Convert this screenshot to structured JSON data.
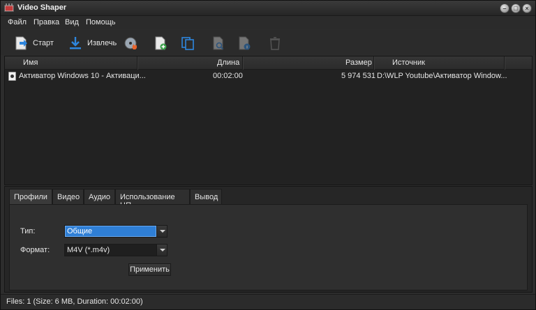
{
  "window": {
    "title": "Video Shaper"
  },
  "menu": [
    "Файл",
    "Правка",
    "Вид",
    "Помощь"
  ],
  "toolbar": {
    "start_label": "Старт",
    "extract_label": "Извлечь"
  },
  "list": {
    "columns": [
      "Имя",
      "Длина",
      "Размер",
      "Источник"
    ],
    "rows": [
      {
        "name": "Активатор Windows 10 - Активаци...",
        "duration": "00:02:00",
        "size": "5 974 531",
        "source": "D:\\WLP Youtube\\Активатор Window..."
      }
    ]
  },
  "tabs": [
    "Профили",
    "Видео",
    "Аудио",
    "Использование ЦП",
    "Вывод"
  ],
  "profile": {
    "type_label": "Тип:",
    "type_value": "Общие",
    "format_label": "Формат:",
    "format_value": "M4V (*.m4v)",
    "apply_label": "Применить"
  },
  "status": "Files: 1 (Size: 6 MB, Duration: 00:02:00)",
  "colors": {
    "selection": "#2f7fd6",
    "background": "#2d2d2d"
  }
}
